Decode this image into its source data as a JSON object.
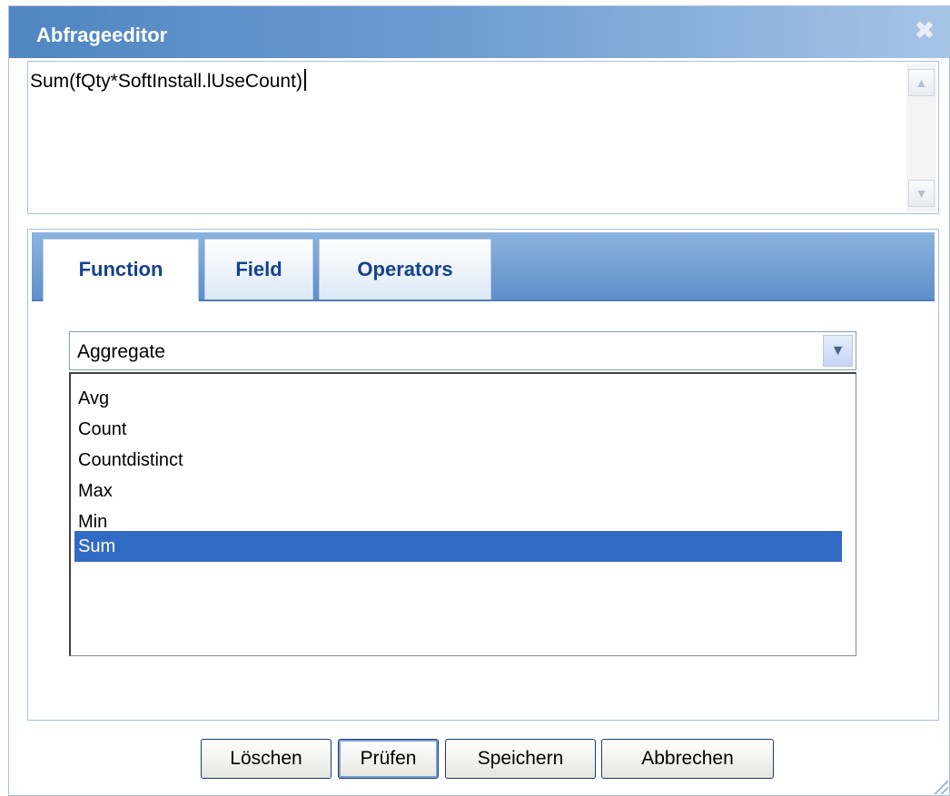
{
  "dialog": {
    "title": "Abfrageeditor",
    "close_icon": "close-icon"
  },
  "expression": {
    "value": "Sum(fQty*SoftInstall.lUseCount)"
  },
  "tabs": [
    {
      "label": "Function",
      "active": true
    },
    {
      "label": "Field",
      "active": false
    },
    {
      "label": "Operators",
      "active": false
    }
  ],
  "category_select": {
    "selected": "Aggregate"
  },
  "function_list": {
    "items": [
      "Avg",
      "Count",
      "Countdistinct",
      "Max",
      "Min",
      "Sum"
    ],
    "selected": "Sum"
  },
  "buttons": {
    "clear": "Löschen",
    "check": "Prüfen",
    "save": "Speichern",
    "cancel": "Abbrechen"
  },
  "colors": {
    "titlebar": "#4f86c1",
    "selection": "#316ac5",
    "tab_text": "#15428b"
  }
}
